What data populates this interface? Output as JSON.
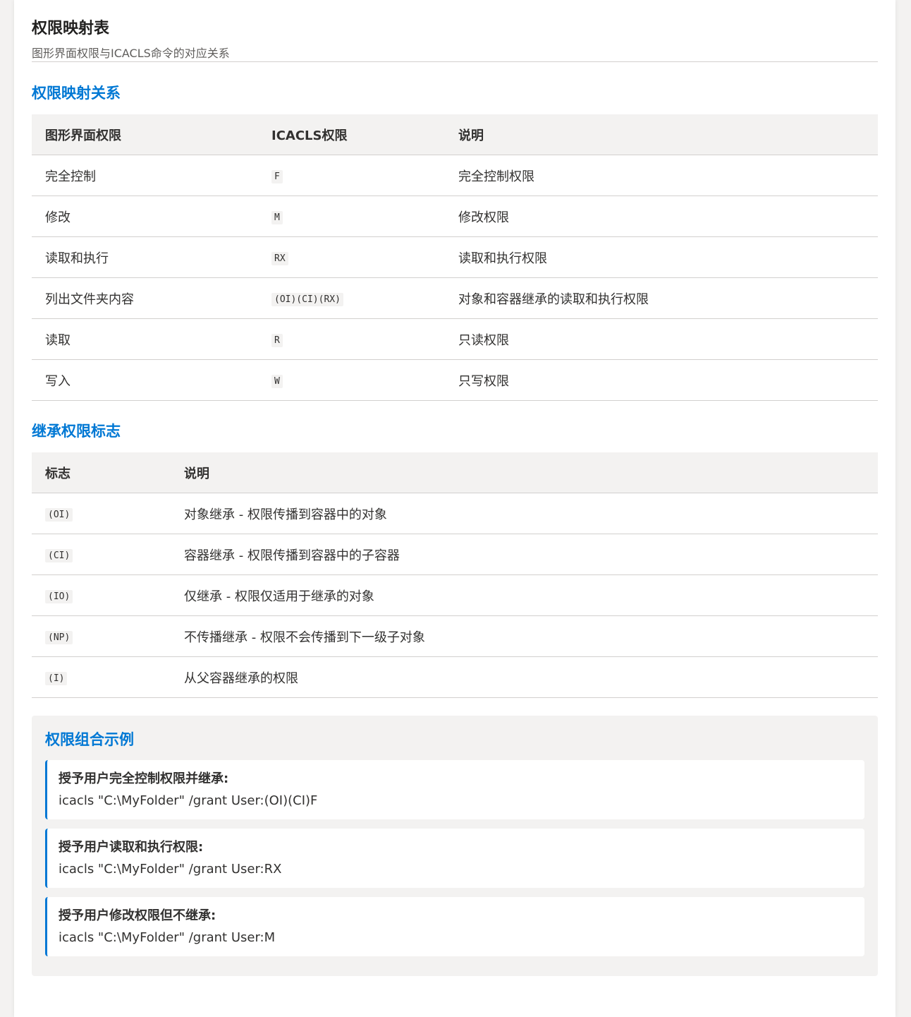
{
  "page": {
    "title": "权限映射表",
    "subtitle": "图形界面权限与ICACLS命令的对应关系"
  },
  "mapping": {
    "section_title": "权限映射关系",
    "headers": [
      "图形界面权限",
      "ICACLS权限",
      "说明"
    ],
    "rows": [
      {
        "gui": "完全控制",
        "icacls": "F",
        "desc": "完全控制权限"
      },
      {
        "gui": "修改",
        "icacls": "M",
        "desc": "修改权限"
      },
      {
        "gui": "读取和执行",
        "icacls": "RX",
        "desc": "读取和执行权限"
      },
      {
        "gui": "列出文件夹内容",
        "icacls": "(OI)(CI)(RX)",
        "desc": "对象和容器继承的读取和执行权限"
      },
      {
        "gui": "读取",
        "icacls": "R",
        "desc": "只读权限"
      },
      {
        "gui": "写入",
        "icacls": "W",
        "desc": "只写权限"
      }
    ]
  },
  "inheritance": {
    "section_title": "继承权限标志",
    "headers": [
      "标志",
      "说明"
    ],
    "rows": [
      {
        "flag": "(OI)",
        "desc": "对象继承 - 权限传播到容器中的对象"
      },
      {
        "flag": "(CI)",
        "desc": "容器继承 - 权限传播到容器中的子容器"
      },
      {
        "flag": "(IO)",
        "desc": "仅继承 - 权限仅适用于继承的对象"
      },
      {
        "flag": "(NP)",
        "desc": "不传播继承 - 权限不会传播到下一级子对象"
      },
      {
        "flag": "(I)",
        "desc": "从父容器继承的权限"
      }
    ]
  },
  "examples": {
    "section_title": "权限组合示例",
    "items": [
      {
        "label": "授予用户完全控制权限并继承:",
        "command": "icacls \"C:\\MyFolder\" /grant User:(OI)(CI)F"
      },
      {
        "label": "授予用户读取和执行权限:",
        "command": "icacls \"C:\\MyFolder\" /grant User:RX"
      },
      {
        "label": "授予用户修改权限但不继承:",
        "command": "icacls \"C:\\MyFolder\" /grant User:M"
      }
    ]
  },
  "colors": {
    "accent": "#0078d4",
    "header_bg": "#f3f2f1",
    "border": "#d2d0ce",
    "text": "#323130"
  }
}
